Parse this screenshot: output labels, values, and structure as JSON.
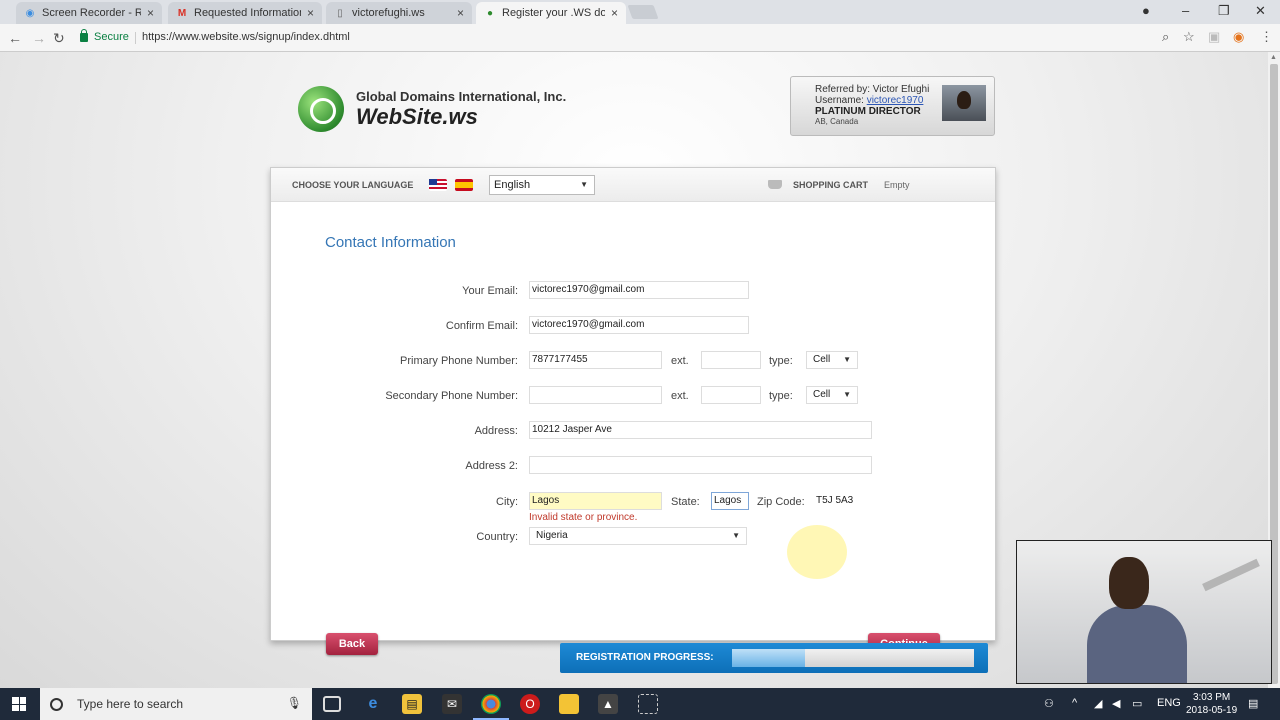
{
  "browser": {
    "tabs": [
      {
        "label": "Screen Recorder - Reco",
        "active": false
      },
      {
        "label": "Requested Information -",
        "active": false
      },
      {
        "label": "victorefughi.ws",
        "active": false
      },
      {
        "label": "Register your .WS domai",
        "active": true
      }
    ],
    "secure_label": "Secure",
    "url": "https://www.website.ws/signup/index.dhtml"
  },
  "logo": {
    "company": "Global Domains International, Inc.",
    "brand": "WebSite.ws"
  },
  "referral": {
    "referred_by": "Referred by: Victor Efughi",
    "username_label": "Username:",
    "username": "victorec1970",
    "title": "PLATINUM DIRECTOR",
    "location": "AB, Canada"
  },
  "header": {
    "language_label": "CHOOSE YOUR LANGUAGE",
    "language": "English",
    "cart_label": "SHOPPING CART",
    "cart_status": "Empty"
  },
  "form": {
    "title": "Contact Information",
    "email_label": "Your Email:",
    "email": "victorec1970@gmail.com",
    "confirm_email_label": "Confirm Email:",
    "confirm_email": "victorec1970@gmail.com",
    "primary_phone_label": "Primary Phone Number:",
    "primary_phone": "7877177455",
    "primary_ext_label": "ext.",
    "primary_ext": "",
    "primary_type_label": "type:",
    "primary_type": "Cell",
    "secondary_phone_label": "Secondary Phone Number:",
    "secondary_phone": "",
    "secondary_ext_label": "ext.",
    "secondary_ext": "",
    "secondary_type_label": "type:",
    "secondary_type": "Cell",
    "address_label": "Address:",
    "address": "10212 Jasper Ave",
    "address2_label": "Address 2:",
    "address2": "",
    "city_label": "City:",
    "city": "Lagos",
    "state_label": "State:",
    "state": "Lagos",
    "zip_label": "Zip Code:",
    "zip": "T5J 5A3",
    "error": "Invalid state or province.",
    "country_label": "Country:",
    "country": "Nigeria",
    "back": "Back",
    "continue": "Continue"
  },
  "progress": {
    "label": "REGISTRATION PROGRESS:",
    "fraction": 0.3
  },
  "taskbar": {
    "search_placeholder": "Type here to search",
    "lang": "ENG",
    "time": "3:03 PM",
    "date": "2018-05-19"
  },
  "colors": {
    "accent": "#3576b5",
    "button": "#c23a58",
    "progress": "#1e8ad6",
    "error": "#c0392b",
    "highlight": "#fffbc4"
  }
}
